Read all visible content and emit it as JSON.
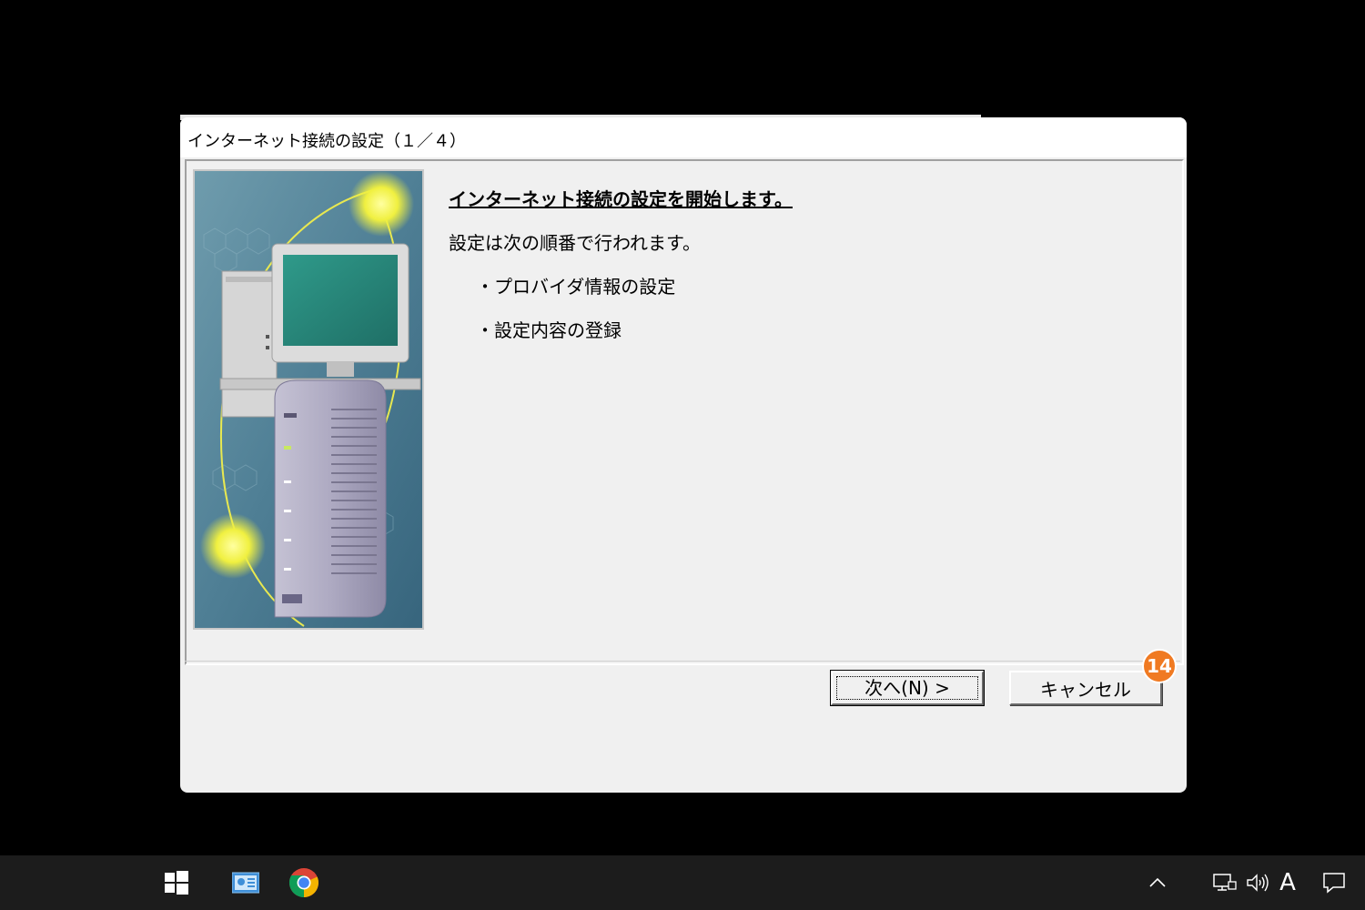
{
  "dialog": {
    "title": "インターネット接続の設定（１／４）",
    "heading": "インターネット接続の設定を開始します。",
    "intro": "設定は次の順番で行われます。",
    "steps": [
      "・プロバイダ情報の設定",
      "・設定内容の登録"
    ],
    "next_label": "次へ(N) >",
    "cancel_label": "キャンセル",
    "badge": "14"
  },
  "taskbar": {
    "ime_label": "A"
  },
  "colors": {
    "dialog_bg": "#f0f0f0",
    "badge": "#f07a22",
    "taskbar": "#1c1c1c"
  }
}
